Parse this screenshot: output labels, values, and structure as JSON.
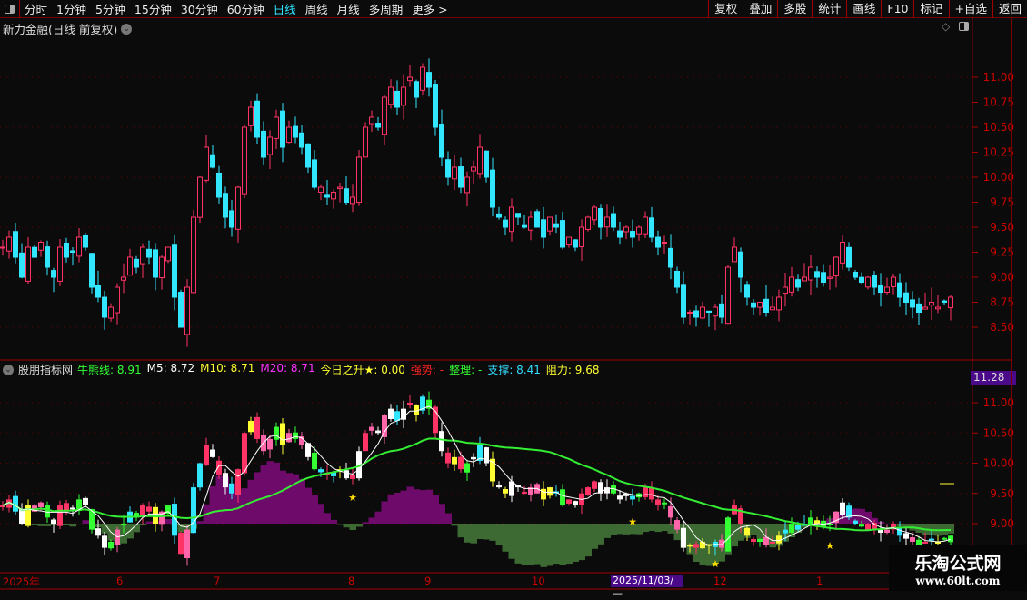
{
  "toolbar": {
    "periods": [
      "分时",
      "1分钟",
      "5分钟",
      "15分钟",
      "30分钟",
      "60分钟",
      "日线",
      "周线",
      "月线",
      "多周期",
      "更多 >"
    ],
    "active_period": "日线",
    "right_buttons": [
      "复权",
      "叠加",
      "多股",
      "统计",
      "画线",
      "F10",
      "标记",
      "+自选",
      "返回"
    ]
  },
  "main": {
    "title": "新力金融(日线 前复权)",
    "y_ticks": [
      "11.00",
      "10.75",
      "10.50",
      "10.25",
      "10.00",
      "9.75",
      "9.50",
      "9.25",
      "9.00",
      "8.75",
      "8.50"
    ]
  },
  "indicator": {
    "name": "股朋指标网",
    "items": [
      {
        "label": "牛熊线: 8.91",
        "color": "#33ff33"
      },
      {
        "label": "M5: 8.72",
        "color": "#ffffff"
      },
      {
        "label": "M10: 8.71",
        "color": "#ffff33"
      },
      {
        "label": "M20: 8.71",
        "color": "#ff33ff"
      },
      {
        "label": "今日之升★: 0.00",
        "color": "#ffff33"
      },
      {
        "label": "强势: -",
        "color": "#ff2222"
      },
      {
        "label": "整理: -",
        "color": "#33ff33"
      },
      {
        "label": "支撑: 8.41",
        "color": "#33ddff"
      },
      {
        "label": "阻力: 9.68",
        "color": "#ffff33"
      }
    ],
    "y_ticks": [
      "11.00",
      "10.50",
      "10.00",
      "9.50",
      "9.00"
    ],
    "current_price": "11.28"
  },
  "x_axis": {
    "labels": [
      "2025年",
      "6",
      "7",
      "8",
      "9",
      "10",
      "12",
      "1"
    ],
    "cursor_date": "2025/11/03/—"
  },
  "watermark": {
    "title": "乐淘公式网",
    "url": "www.60lt.com"
  },
  "chart_data": {
    "type": "candlestick",
    "closes": [
      9.3,
      9.4,
      9.2,
      9.0,
      9.3,
      9.2,
      9.35,
      9.1,
      9.0,
      9.3,
      9.2,
      9.25,
      9.4,
      9.3,
      8.9,
      8.8,
      8.6,
      8.7,
      8.9,
      9.0,
      9.2,
      9.1,
      9.3,
      9.2,
      9.0,
      9.2,
      9.3,
      8.8,
      8.5,
      8.9,
      9.6,
      10.0,
      10.3,
      10.1,
      9.8,
      9.6,
      9.5,
      9.9,
      10.5,
      10.7,
      10.4,
      10.2,
      10.4,
      10.6,
      10.3,
      10.5,
      10.4,
      10.3,
      10.1,
      9.9,
      9.9,
      9.8,
      9.85,
      9.9,
      9.75,
      9.8,
      10.2,
      10.5,
      10.6,
      10.5,
      10.8,
      10.9,
      10.7,
      10.9,
      11.0,
      10.8,
      11.1,
      10.9,
      10.5,
      10.2,
      10.0,
      10.1,
      9.9,
      10.0,
      10.1,
      10.3,
      10.0,
      9.7,
      9.6,
      9.5,
      9.7,
      9.6,
      9.5,
      9.6,
      9.5,
      9.4,
      9.6,
      9.5,
      9.3,
      9.4,
      9.3,
      9.5,
      9.6,
      9.7,
      9.5,
      9.6,
      9.5,
      9.4,
      9.5,
      9.4,
      9.5,
      9.6,
      9.4,
      9.3,
      9.35,
      9.1,
      8.9,
      8.6,
      8.65,
      8.6,
      8.7,
      8.65,
      8.7,
      8.6,
      9.1,
      9.3,
      9.0,
      8.8,
      8.7,
      8.75,
      8.65,
      8.7,
      8.8,
      8.9,
      9.0,
      8.9,
      9.0,
      9.1,
      9.0,
      8.95,
      9.0,
      9.2,
      9.35,
      9.1,
      9.0,
      8.95,
      9.0,
      8.9,
      8.85,
      8.9,
      9.0,
      8.8,
      8.75,
      8.7,
      8.65,
      8.7,
      8.75,
      8.7,
      8.75,
      8.8
    ],
    "up_color": "#ff3366",
    "down_color": "#33e6ff"
  }
}
